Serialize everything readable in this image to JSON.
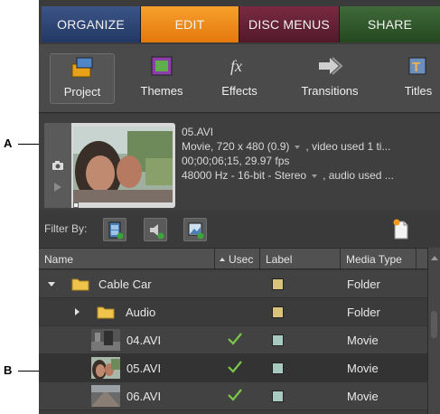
{
  "callouts": {
    "a": "A",
    "b": "B"
  },
  "tabs": [
    {
      "label": "ORGANIZE"
    },
    {
      "label": "EDIT"
    },
    {
      "label": "DISC MENUS"
    },
    {
      "label": "SHARE"
    }
  ],
  "toolbar": {
    "items": [
      {
        "label": "Project",
        "icon": "project-icon",
        "selected": true
      },
      {
        "label": "Themes",
        "icon": "themes-icon"
      },
      {
        "label": "Effects",
        "icon": "effects-icon"
      },
      {
        "label": "Transitions",
        "icon": "transitions-icon"
      },
      {
        "label": "Titles",
        "icon": "titles-icon"
      }
    ]
  },
  "preview": {
    "filename": "05.AVI",
    "line2": "Movie, 720 x 480 (0.9)",
    "line2_tail": ", video used 1 ti...",
    "line3": "00;00;06;15, 29.97 fps",
    "line4": "48000 Hz - 16-bit - Stereo",
    "line4_tail": ", audio used ..."
  },
  "filter": {
    "label": "Filter By:"
  },
  "table": {
    "headers": {
      "name": "Name",
      "used": "Usec",
      "label": "Label",
      "type": "Media Type"
    },
    "rows": [
      {
        "name": "Cable Car",
        "type": "Folder",
        "kind": "folder",
        "expanded": true,
        "indent": 0,
        "swatch": "#d9c27a"
      },
      {
        "name": "Audio",
        "type": "Folder",
        "kind": "folder",
        "expanded": false,
        "indent": 1,
        "swatch": "#d9c27a"
      },
      {
        "name": "04.AVI",
        "type": "Movie",
        "kind": "clip",
        "used": true,
        "swatch": "#a7c9c0"
      },
      {
        "name": "05.AVI",
        "type": "Movie",
        "kind": "clip",
        "used": true,
        "swatch": "#a7c9c0",
        "selected": true
      },
      {
        "name": "06.AVI",
        "type": "Movie",
        "kind": "clip",
        "used": true,
        "swatch": "#a7c9c0"
      }
    ]
  }
}
